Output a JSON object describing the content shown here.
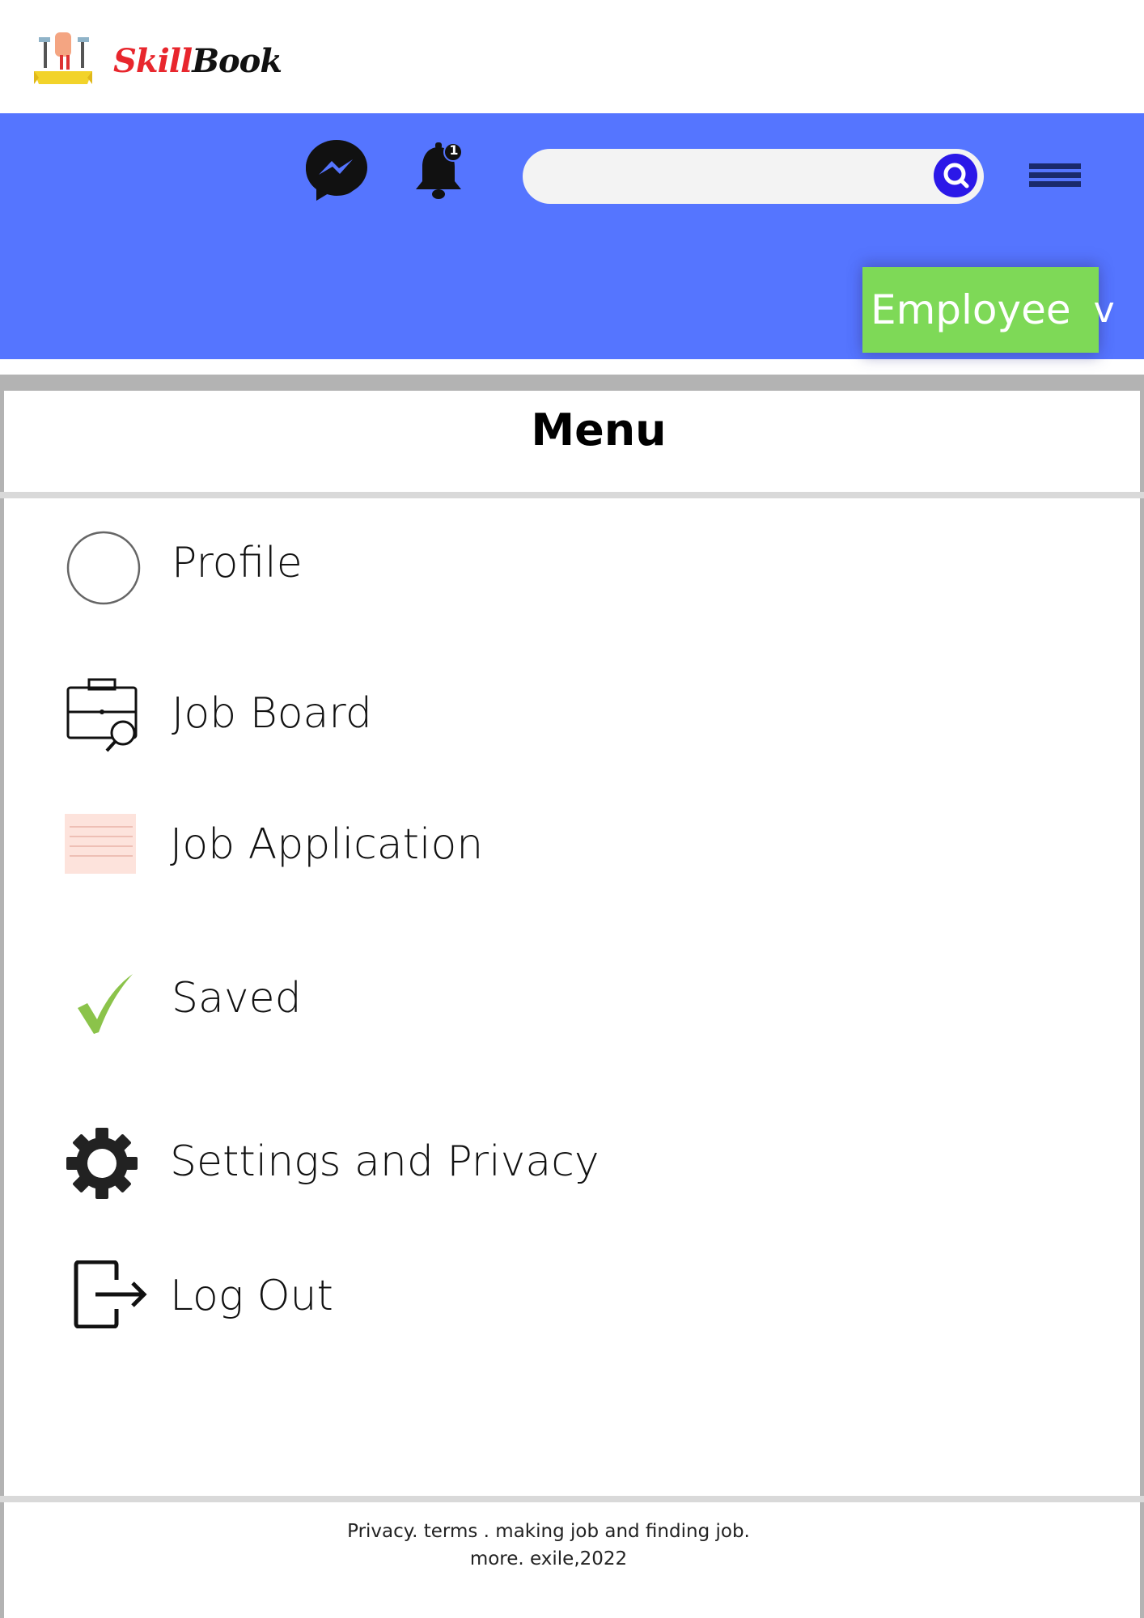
{
  "brand": {
    "name_part1": "Skill",
    "name_part2": "Book"
  },
  "header": {
    "notification_count": "1",
    "search": {
      "value": "",
      "placeholder": ""
    },
    "role_button": {
      "label": "Employee",
      "caret": "v"
    }
  },
  "menu": {
    "title": "Menu",
    "items": [
      {
        "label": "Profile",
        "icon": "profile-circle-icon"
      },
      {
        "label": "Job Board",
        "icon": "briefcase-search-icon"
      },
      {
        "label": "Job Application",
        "icon": "note-paper-icon"
      },
      {
        "label": "Saved",
        "icon": "checkmark-icon"
      },
      {
        "label": "Settings and Privacy",
        "icon": "gear-icon"
      },
      {
        "label": "Log Out",
        "icon": "logout-icon"
      }
    ]
  },
  "footer": {
    "line1": "Privacy. terms . making job and finding job.",
    "line2": "more. exile,2022"
  },
  "colors": {
    "header_bg": "#5575ff",
    "role_button_bg": "#7ed957",
    "search_button": "#2b18e8",
    "check_green": "#8bc34a",
    "brand_red": "#e8262d"
  }
}
